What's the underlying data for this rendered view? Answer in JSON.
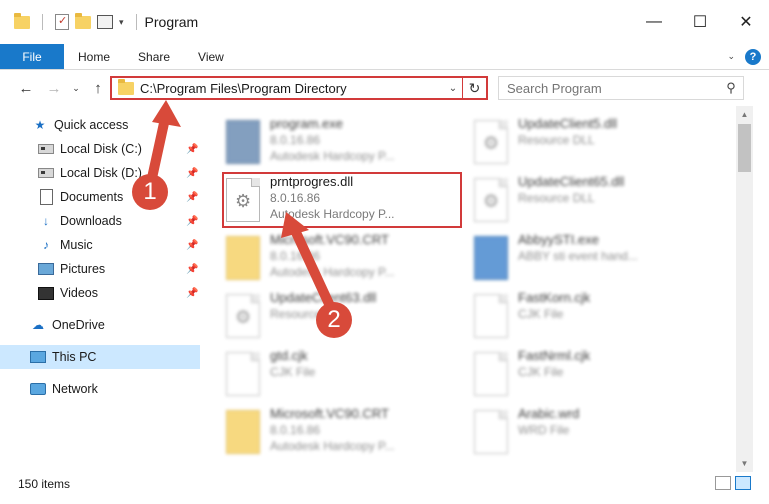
{
  "window": {
    "title": "Program"
  },
  "ribbon": {
    "tabs": [
      "File",
      "Home",
      "Share",
      "View"
    ]
  },
  "address": {
    "path": "C:\\Program Files\\Program Directory"
  },
  "search": {
    "placeholder": "Search Program"
  },
  "nav": {
    "items": [
      {
        "label": "Quick access",
        "icon": "star-icon"
      },
      {
        "label": "Local Disk (C:)",
        "icon": "disk-icon",
        "pinned": true
      },
      {
        "label": "Local Disk (D:)",
        "icon": "disk-icon",
        "pinned": true
      },
      {
        "label": "Documents",
        "icon": "document-icon",
        "pinned": true
      },
      {
        "label": "Downloads",
        "icon": "download-icon",
        "pinned": true
      },
      {
        "label": "Music",
        "icon": "music-icon",
        "pinned": true
      },
      {
        "label": "Pictures",
        "icon": "picture-icon",
        "pinned": true
      },
      {
        "label": "Videos",
        "icon": "video-icon",
        "pinned": true
      },
      {
        "label": "OneDrive",
        "icon": "cloud-icon"
      },
      {
        "label": "This PC",
        "icon": "computer-icon",
        "selected": true
      },
      {
        "label": "Network",
        "icon": "network-icon"
      }
    ]
  },
  "files": [
    {
      "name": "program.exe",
      "line2": "8.0.16.86",
      "line3": "Autodesk Hardcopy P...",
      "icon": "exe"
    },
    {
      "name": "UpdateClient5.dll",
      "line2": "Resource DLL",
      "line3": "",
      "icon": "gear"
    },
    {
      "name": "prntprogres.dll",
      "line2": "8.0.16.86",
      "line3": "Autodesk Hardcopy P...",
      "icon": "gear",
      "highlight": true
    },
    {
      "name": "UpdateClient65.dll",
      "line2": "Resource DLL",
      "line3": "",
      "icon": "gear"
    },
    {
      "name": "Microsoft.VC90.CRT",
      "line2": "8.0.16.86",
      "line3": "Autodesk Hardcopy P...",
      "icon": "folder"
    },
    {
      "name": "AbbyySTI.exe",
      "line2": "ABBY sti event hand...",
      "line3": "",
      "icon": "app"
    },
    {
      "name": "UpdateClient63.dll",
      "line2": "Resource DLL",
      "line3": "",
      "icon": "gear"
    },
    {
      "name": "FastKorn.cjk",
      "line2": "CJK File",
      "line3": "",
      "icon": "generic"
    },
    {
      "name": "gtd.cjk",
      "line2": "CJK File",
      "line3": "",
      "icon": "generic"
    },
    {
      "name": "FastNrml.cjk",
      "line2": "CJK File",
      "line3": "",
      "icon": "generic"
    },
    {
      "name": "Microsoft.VC90.CRT",
      "line2": "8.0.16.86",
      "line3": "Autodesk Hardcopy P...",
      "icon": "folder"
    },
    {
      "name": "Arabic.wrd",
      "line2": "WRD File",
      "line3": "",
      "icon": "generic"
    }
  ],
  "status": {
    "count": "150 items"
  },
  "callouts": [
    "1",
    "2"
  ],
  "colors": {
    "accent": "#1979ca",
    "annotation": "#d23a3a"
  }
}
